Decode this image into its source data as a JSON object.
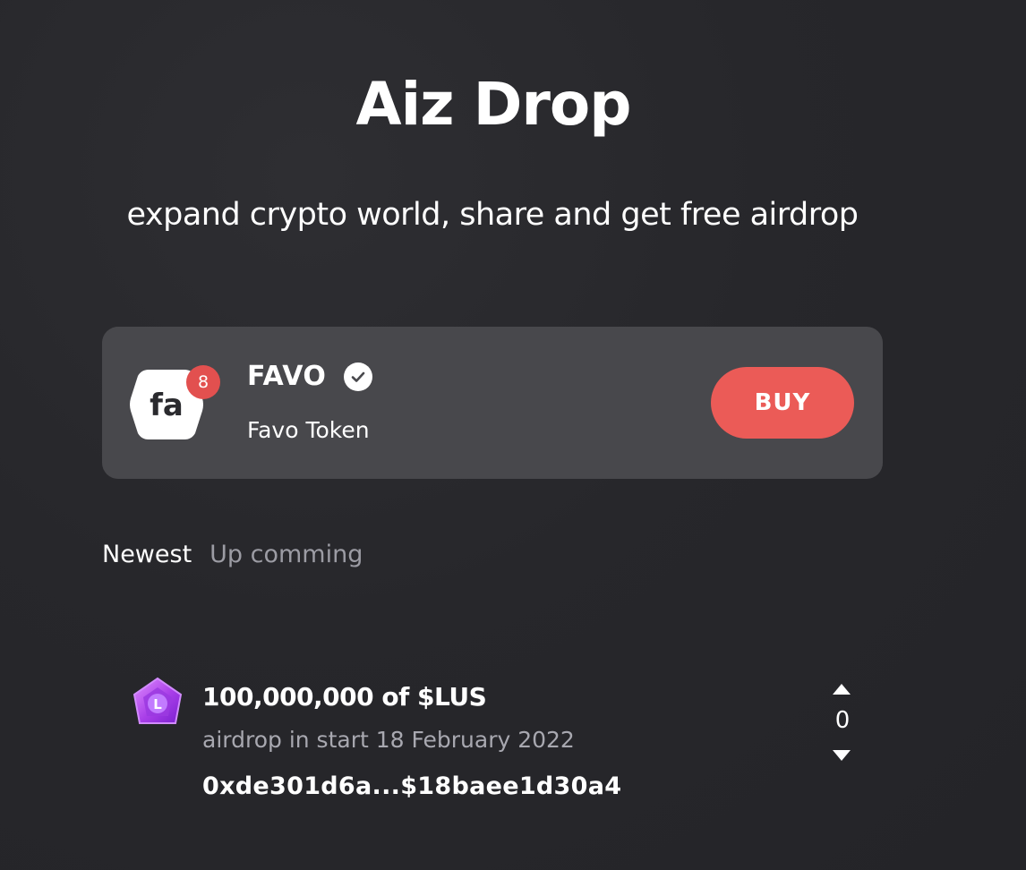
{
  "header": {
    "title": "Aiz Drop",
    "subtitle": "expand crypto world, share and get free airdrop"
  },
  "featured_token": {
    "logo_text": "fa",
    "logo_icon": "favo-logo-icon",
    "badge_count": "8",
    "symbol": "FAVO",
    "verified_icon": "verified-check-icon",
    "name": "Favo Token",
    "buy_label": "BUY",
    "buy_color": "#eb5b57"
  },
  "tabs": [
    {
      "label": "Newest",
      "active": true
    },
    {
      "label": "Up comming",
      "active": false
    }
  ],
  "airdrops": [
    {
      "icon": "lus-token-icon",
      "icon_letter": "L",
      "amount": "100,000,000 of $LUS",
      "date_text": "airdrop in start 18 February 2022",
      "address": "0xde301d6a...$18baee1d30a4",
      "votes": "0"
    }
  ]
}
